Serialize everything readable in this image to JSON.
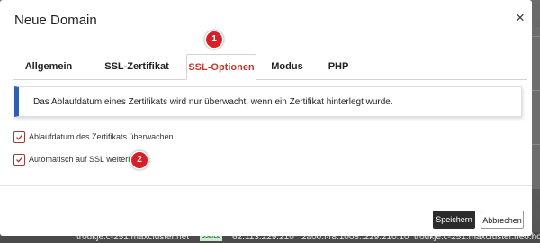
{
  "dialog": {
    "title": "Neue Domain",
    "close_symbol": "×"
  },
  "tabs": [
    {
      "label": "Allgemein",
      "active": false
    },
    {
      "label": "SSL-Zertifikat",
      "active": false
    },
    {
      "label": "SSL-Optionen",
      "active": true
    },
    {
      "label": "Modus",
      "active": false
    },
    {
      "label": "PHP",
      "active": false
    }
  ],
  "markers": [
    "1",
    "2"
  ],
  "info": {
    "text": "Das Ablaufdatum eines Zertifikats wird nur überwacht, wenn ein Zertifikat hinterlegt wurde."
  },
  "options": [
    {
      "label": "Ablaufdatum des Zertifikats überwachen",
      "checked": true
    },
    {
      "label": "Automatisch auf SSL weiterleiten",
      "checked": true
    }
  ],
  "buttons": {
    "save": "Speichern",
    "cancel": "Abbrechen"
  },
  "background_row": {
    "domain": "troukje.c-251.maxcluster.net",
    "badge": "SSL/LE",
    "ipv4": "62.113.229.210",
    "ipv6": "2a00:f48:1008::229:210:10",
    "alias": "troukje.c-251.maxcluster.neo.hode"
  },
  "colors": {
    "accent_red": "#c0392b",
    "info_border": "#2e5fb4",
    "primary_button": "#2c2c2c"
  }
}
